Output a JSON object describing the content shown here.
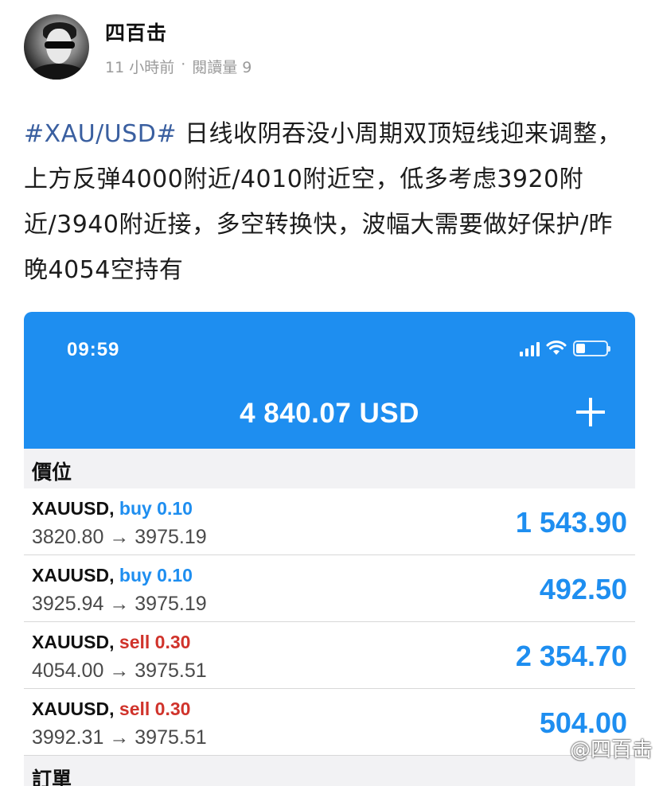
{
  "author": {
    "name": "四百击",
    "time": "11 小時前",
    "separator": "·",
    "reads": "閱讀量 9"
  },
  "post": {
    "hashtag": "#XAU/USD#",
    "text": " 日线收阴吞没小周期双顶短线迎来调整，上方反弹4000附近/4010附近空，低多考虑3920附近/3940附近接，多空转换快，波幅大需要做好保护/昨晚4054空持有"
  },
  "app": {
    "status_time": "09:59",
    "battery_level": 0.3,
    "balance": "4 840.07 USD",
    "positions_header": "價位",
    "orders_header": "訂單",
    "accent_color": "#1e8ef0",
    "sell_color": "#d0332b",
    "positions": [
      {
        "symbol": "XAUUSD,",
        "side": "buy 0.10",
        "prices": "3820.80 → 3975.19",
        "profit": "1 543.90"
      },
      {
        "symbol": "XAUUSD,",
        "side": "buy 0.10",
        "prices": "3925.94 → 3975.19",
        "profit": "492.50"
      },
      {
        "symbol": "XAUUSD,",
        "side": "sell 0.30",
        "prices": "4054.00 → 3975.51",
        "profit": "2 354.70"
      },
      {
        "symbol": "XAUUSD,",
        "side": "sell 0.30",
        "prices": "3992.31 → 3975.51",
        "profit": "504.00"
      }
    ]
  },
  "watermark": "@四百击"
}
